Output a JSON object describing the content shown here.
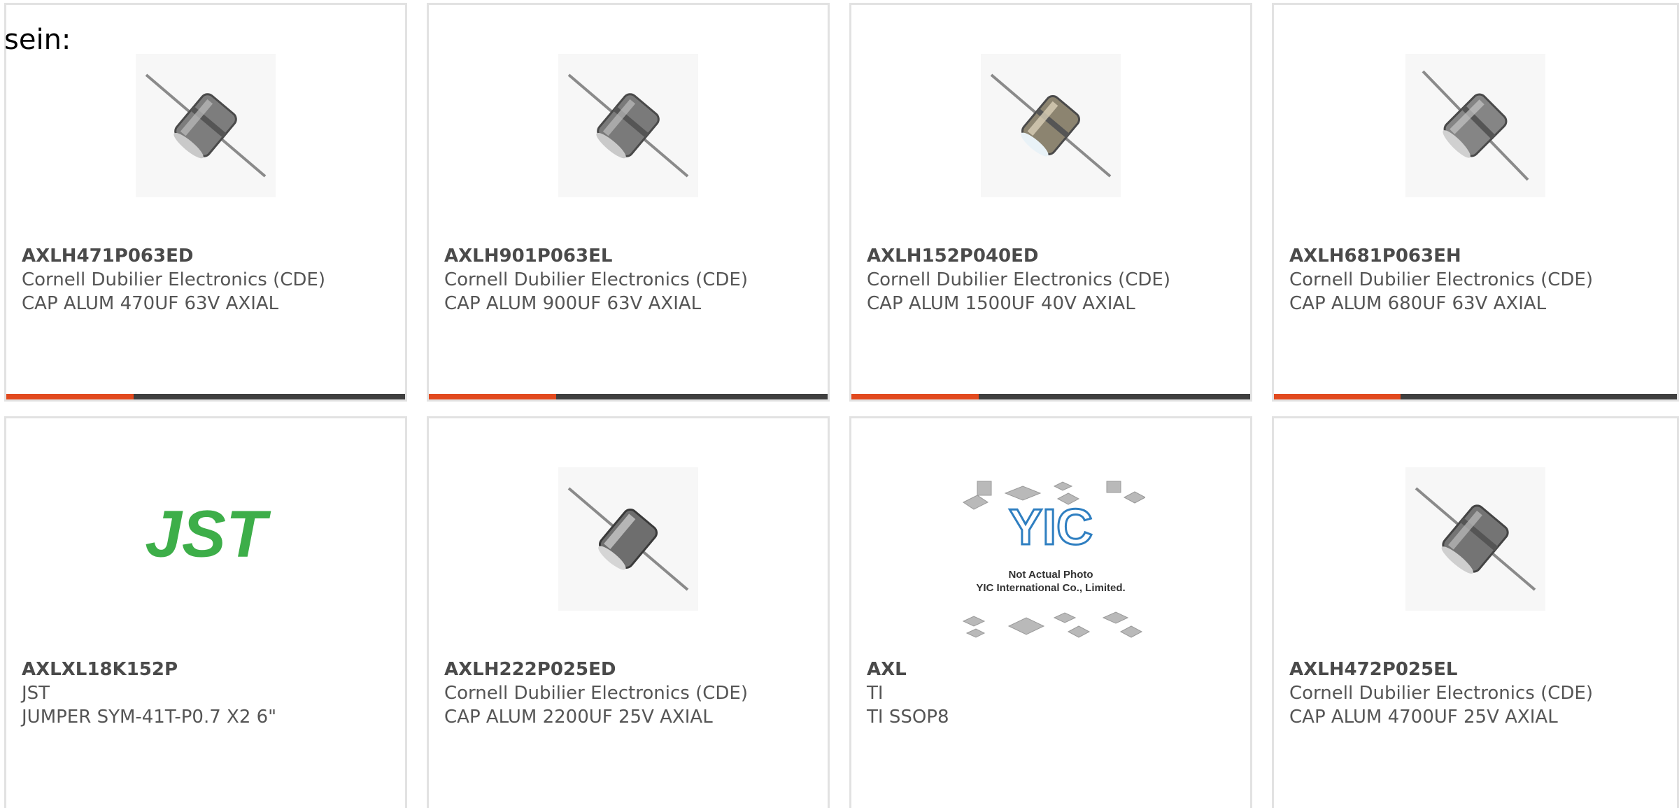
{
  "intro_text": "sein:",
  "accent_color": "#e24a1f",
  "products": [
    {
      "part_number": "AXLH471P063ED",
      "manufacturer": "Cornell Dubilier Electronics (CDE)",
      "description": "CAP ALUM 470UF 63V AXIAL",
      "image": "axial-capacitor-icon",
      "progress": 0.32
    },
    {
      "part_number": "AXLH901P063EL",
      "manufacturer": "Cornell Dubilier Electronics (CDE)",
      "description": "CAP ALUM 900UF 63V AXIAL",
      "image": "axial-capacitor-icon",
      "progress": 0.32
    },
    {
      "part_number": "AXLH152P040ED",
      "manufacturer": "Cornell Dubilier Electronics (CDE)",
      "description": "CAP ALUM 1500UF 40V AXIAL",
      "image": "axial-capacitor-icon",
      "progress": 0.32
    },
    {
      "part_number": "AXLH681P063EH",
      "manufacturer": "Cornell Dubilier Electronics (CDE)",
      "description": "CAP ALUM 680UF 63V AXIAL",
      "image": "axial-capacitor-icon",
      "progress": 0.32
    },
    {
      "part_number": "AXLXL18K152P",
      "manufacturer": "JST",
      "description": "JUMPER SYM-41T-P0.7 X2 6\"",
      "image": "jst-logo",
      "logo_text": "JST",
      "logo_color": "#3dae49"
    },
    {
      "part_number": "AXLH222P025ED",
      "manufacturer": "Cornell Dubilier Electronics (CDE)",
      "description": "CAP ALUM 2200UF 25V AXIAL",
      "image": "axial-capacitor-icon"
    },
    {
      "part_number": "AXL",
      "manufacturer": "TI",
      "description": "TI SSOP8",
      "image": "yic-placeholder-image",
      "placeholder_line1": "Not Actual Photo",
      "placeholder_line2": "YIC International Co., Limited."
    },
    {
      "part_number": "AXLH472P025EL",
      "manufacturer": "Cornell Dubilier Electronics (CDE)",
      "description": "CAP ALUM 4700UF 25V AXIAL",
      "image": "axial-capacitor-icon"
    }
  ]
}
